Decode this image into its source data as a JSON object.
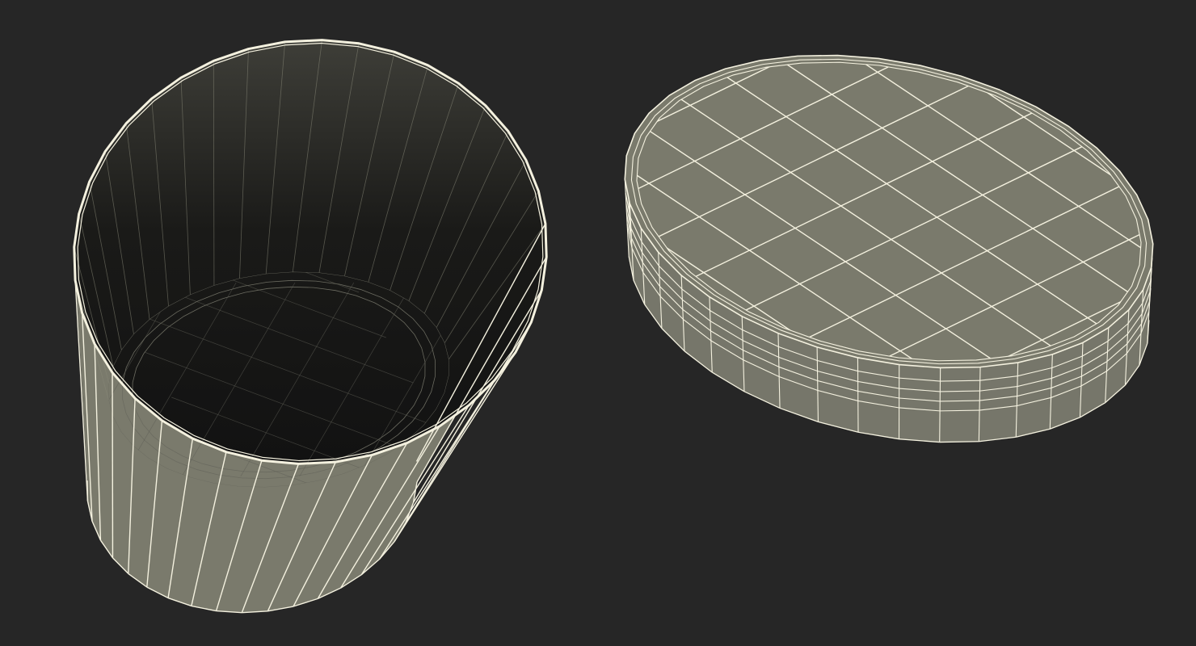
{
  "scene": {
    "background": "#262626",
    "mesh_fill": "#7a7a6c",
    "wire_color": "#f4f1df",
    "interior_light": "#3e3e38",
    "interior_dark": "#121212",
    "cup": {
      "segments": 40
    },
    "lid": {
      "segments": 40,
      "grid_lines_per_axis": 8
    }
  }
}
